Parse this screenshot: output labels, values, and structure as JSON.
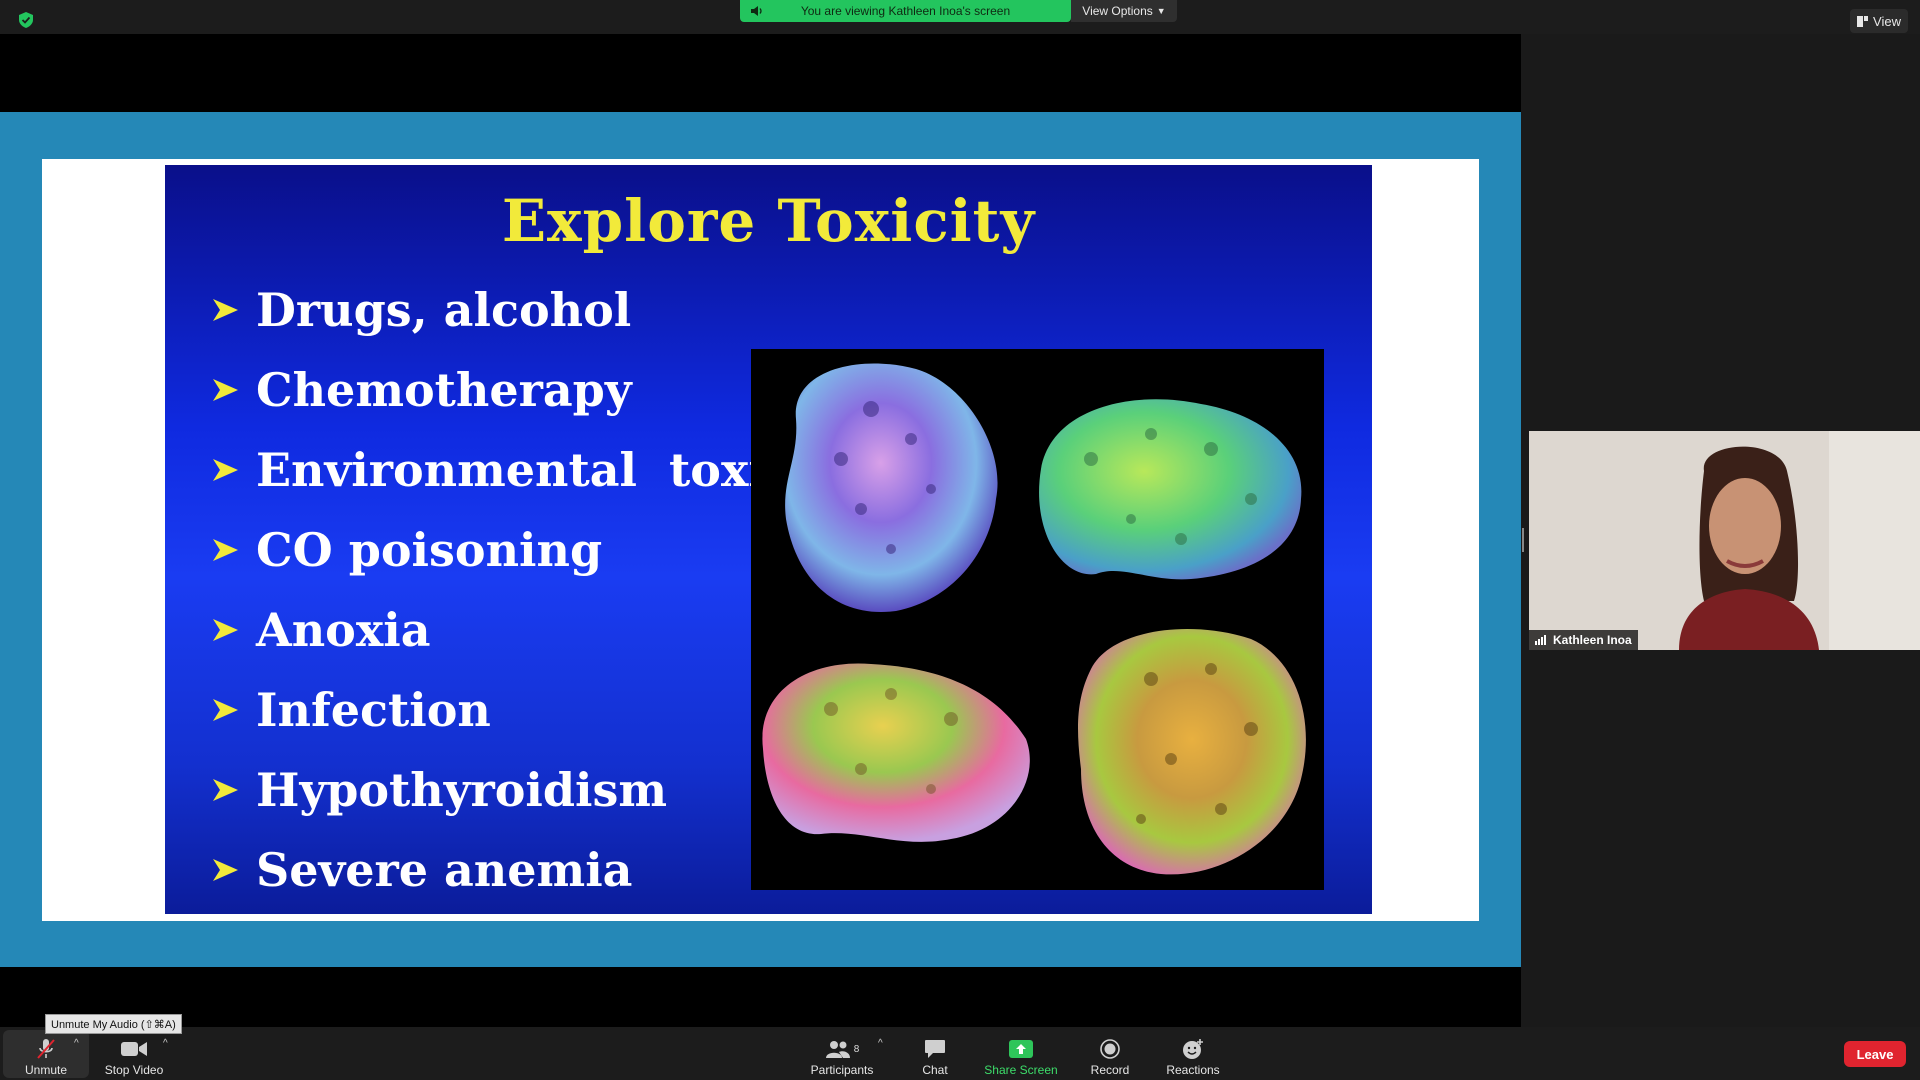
{
  "top_bar": {
    "share_banner_text": "You are viewing Kathleen Inoa's screen",
    "view_options_label": "View Options",
    "view_label": "View"
  },
  "slide": {
    "title": "Explore Toxicity",
    "bullets": [
      "Drugs, alcohol",
      "Chemotherapy",
      "Environmental  toxin",
      "CO poisoning",
      "Anoxia",
      "Infection",
      "Hypothyroidism",
      "Severe anemia"
    ]
  },
  "participant": {
    "name": "Kathleen Inoa"
  },
  "toolbar": {
    "tooltip": "Unmute My Audio (⇧⌘A)",
    "unmute_label": "Unmute",
    "stop_video_label": "Stop Video",
    "participants_label": "Participants",
    "participants_count": "8",
    "chat_label": "Chat",
    "share_screen_label": "Share Screen",
    "record_label": "Record",
    "reactions_label": "Reactions",
    "leave_label": "Leave"
  },
  "colors": {
    "share_green": "#23c55e",
    "slide_title_yellow": "#f2ea3a",
    "frame_blue": "#2588b7",
    "leave_red": "#e0242f"
  }
}
